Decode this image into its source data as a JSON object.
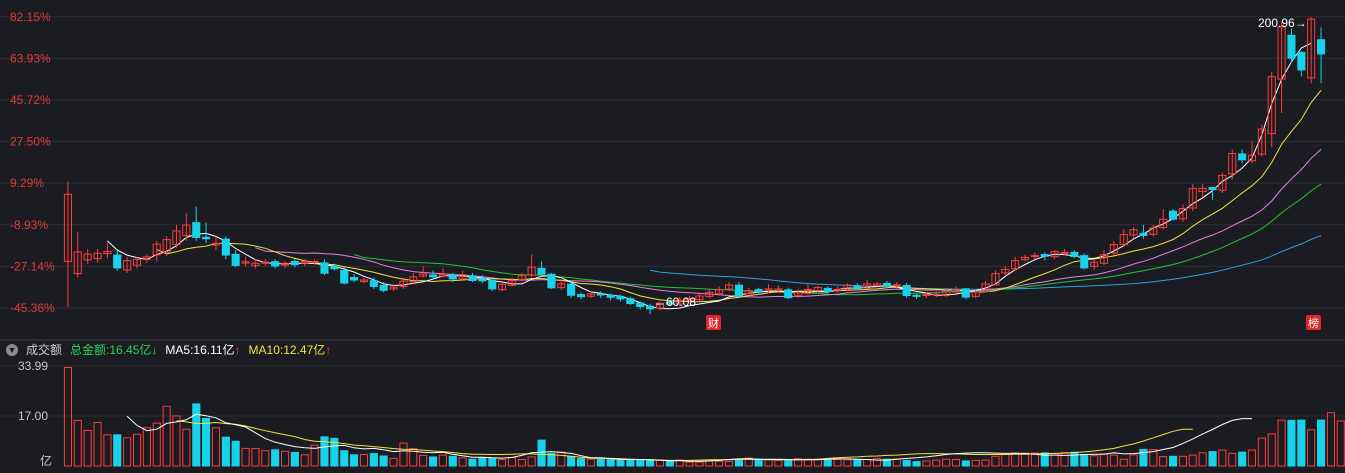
{
  "colors": {
    "up": "#ff3b3b",
    "down": "#19d2ea",
    "ma5": "#ffffff",
    "ma10": "#f2e33c",
    "ma20": "#e67ee6",
    "ma30": "#22c234",
    "ma60": "#2f9fe0",
    "grid": "#2c2e35"
  },
  "volume_header": {
    "collapse_icon": "triangle-down-icon",
    "name": "成交额",
    "total_label": "总金额:16.45亿",
    "total_arrow": "↓",
    "ma5_label": "MA5:16.11亿",
    "ma5_arrow": "↑",
    "ma10_label": "MA10:12.47亿",
    "ma10_arrow": "↑"
  },
  "annotations": {
    "high_label": "200.96→",
    "low_label": "←60.08",
    "badge_cai": "财",
    "badge_bang": "榜"
  },
  "chart_data": [
    {
      "type": "candlestick",
      "y_axis_format": "percent",
      "yticks": [
        "82.15%",
        "63.93%",
        "45.72%",
        "27.50%",
        "9.29%",
        "-8.93%",
        "-27.14%",
        "-45.36%"
      ],
      "ytick_values": [
        82.15,
        63.93,
        45.72,
        27.5,
        9.29,
        -8.93,
        -27.14,
        -45.36
      ],
      "ylim": [
        -55,
        86
      ],
      "candles": [
        [
          -25.0,
          4.4,
          10.0,
          -45.0
        ],
        [
          -30.3,
          -20.8,
          -12.0,
          -32.0
        ],
        [
          -24.3,
          -21.7,
          -19.5,
          -26.0
        ],
        [
          -23.7,
          -21.4,
          -19.5,
          -25.5
        ],
        [
          -21.5,
          -20.6,
          -17.0,
          -23.5
        ],
        [
          -22.2,
          -27.8,
          -20.0,
          -29.0
        ],
        [
          -28.7,
          -24.6,
          -23.0,
          -30.0
        ],
        [
          -26.7,
          -24.1,
          -23.0,
          -28.0
        ],
        [
          -24.2,
          -23.0,
          -22.0,
          -25.5
        ],
        [
          -22.1,
          -17.4,
          -16.0,
          -25.0
        ],
        [
          -21.0,
          -15.4,
          -14.0,
          -22.5
        ],
        [
          -17.5,
          -11.6,
          -9.0,
          -19.0
        ],
        [
          -13.6,
          -9.0,
          -4.0,
          -16.0
        ],
        [
          -8.0,
          -14.5,
          -1.0,
          -16.0
        ],
        [
          -14.4,
          -15.0,
          -8.0,
          -17.0
        ],
        [
          -17.8,
          -17.1,
          -14.0,
          -20.0
        ],
        [
          -15.2,
          -22.2,
          -14.0,
          -24.0
        ],
        [
          -21.9,
          -26.7,
          -20.0,
          -27.5
        ],
        [
          -25.7,
          -25.1,
          -23.0,
          -27.0
        ],
        [
          -26.8,
          -25.8,
          -24.0,
          -28.0
        ],
        [
          -25.8,
          -25.3,
          -24.0,
          -27.0
        ],
        [
          -25.1,
          -27.0,
          -24.0,
          -28.0
        ],
        [
          -26.6,
          -25.8,
          -25.0,
          -28.0
        ],
        [
          -25.0,
          -26.4,
          -24.0,
          -27.5
        ],
        [
          -25.7,
          -25.0,
          -24.0,
          -27.0
        ],
        [
          -25.4,
          -25.0,
          -24.0,
          -26.5
        ],
        [
          -25.6,
          -30.1,
          -24.0,
          -31.0
        ],
        [
          -27.3,
          -28.2,
          -26.0,
          -29.0
        ],
        [
          -28.9,
          -34.4,
          -27.0,
          -35.0
        ],
        [
          -32.0,
          -33.1,
          -30.5,
          -34.0
        ],
        [
          -33.8,
          -33.1,
          -32.0,
          -34.5
        ],
        [
          -33.4,
          -35.9,
          -32.0,
          -37.0
        ],
        [
          -35.5,
          -37.6,
          -34.0,
          -38.5
        ],
        [
          -37.0,
          -36.2,
          -35.0,
          -38.0
        ],
        [
          -36.0,
          -33.6,
          -32.0,
          -37.0
        ],
        [
          -33.8,
          -31.7,
          -30.0,
          -35.0
        ],
        [
          -31.4,
          -30.5,
          -27.0,
          -32.0
        ],
        [
          -30.9,
          -31.7,
          -29.0,
          -33.0
        ],
        [
          -31.4,
          -30.6,
          -28.0,
          -32.0
        ],
        [
          -30.9,
          -32.6,
          -30.0,
          -34.0
        ],
        [
          -32.6,
          -30.8,
          -29.0,
          -33.0
        ],
        [
          -31.3,
          -33.3,
          -30.0,
          -34.0
        ],
        [
          -32.6,
          -33.5,
          -31.0,
          -34.5
        ],
        [
          -33.3,
          -37.0,
          -32.5,
          -38.0
        ],
        [
          -37.3,
          -35.0,
          -34.0,
          -38.0
        ],
        [
          -35.4,
          -33.4,
          -32.0,
          -36.0
        ],
        [
          -33.0,
          -31.2,
          -30.0,
          -34.0
        ],
        [
          -31.0,
          -27.5,
          -22.0,
          -32.0
        ],
        [
          -28.0,
          -30.6,
          -25.0,
          -31.5
        ],
        [
          -30.6,
          -36.5,
          -30.0,
          -37.0
        ],
        [
          -36.4,
          -34.8,
          -33.0,
          -37.5
        ],
        [
          -34.9,
          -39.8,
          -34.0,
          -41.0
        ],
        [
          -39.5,
          -40.4,
          -38.5,
          -41.5
        ],
        [
          -40.2,
          -39.2,
          -38.0,
          -41.0
        ],
        [
          -39.2,
          -39.7,
          -38.0,
          -41.0
        ],
        [
          -39.7,
          -40.6,
          -39.0,
          -42.0
        ],
        [
          -40.3,
          -41.4,
          -39.5,
          -42.5
        ],
        [
          -41.3,
          -43.4,
          -40.5,
          -44.0
        ],
        [
          -43.2,
          -44.7,
          -42.5,
          -46.0
        ],
        [
          -44.6,
          -45.8,
          -43.5,
          -48.0
        ],
        [
          -45.4,
          -43.3,
          -42.5,
          -46.5
        ],
        [
          -43.0,
          -43.7,
          -42.0,
          -44.5
        ],
        [
          -43.6,
          -41.9,
          -40.5,
          -44.5
        ],
        [
          -42.2,
          -41.2,
          -40.0,
          -43.0
        ],
        [
          -41.7,
          -40.1,
          -39.0,
          -42.5
        ],
        [
          -40.3,
          -38.5,
          -37.0,
          -41.0
        ],
        [
          -39.1,
          -37.4,
          -36.0,
          -40.0
        ],
        [
          -37.1,
          -35.3,
          -34.0,
          -38.0
        ],
        [
          -35.4,
          -40.0,
          -34.0,
          -41.0
        ],
        [
          -39.0,
          -37.7,
          -36.5,
          -40.0
        ],
        [
          -37.3,
          -38.2,
          -36.5,
          -39.5
        ],
        [
          -37.6,
          -37.0,
          -35.0,
          -39.0
        ],
        [
          -37.6,
          -37.0,
          -35.5,
          -38.5
        ],
        [
          -37.4,
          -40.8,
          -36.5,
          -41.5
        ],
        [
          -40.0,
          -38.6,
          -37.0,
          -41.0
        ],
        [
          -38.9,
          -37.2,
          -35.0,
          -39.5
        ],
        [
          -37.7,
          -36.4,
          -35.5,
          -38.5
        ],
        [
          -36.8,
          -38.1,
          -36.0,
          -39.0
        ],
        [
          -37.8,
          -37.2,
          -36.0,
          -38.5
        ],
        [
          -37.2,
          -35.3,
          -34.5,
          -38.0
        ],
        [
          -35.7,
          -36.9,
          -34.5,
          -37.5
        ],
        [
          -36.6,
          -34.8,
          -33.0,
          -37.0
        ],
        [
          -35.5,
          -34.8,
          -34.0,
          -36.5
        ],
        [
          -34.6,
          -35.6,
          -33.5,
          -36.5
        ],
        [
          -35.2,
          -35.2,
          -34.0,
          -36.5
        ],
        [
          -35.5,
          -39.9,
          -34.5,
          -41.0
        ],
        [
          -39.8,
          -40.3,
          -39.0,
          -41.5
        ],
        [
          -39.9,
          -39.4,
          -38.5,
          -41.0
        ],
        [
          -39.7,
          -39.3,
          -38.0,
          -40.5
        ],
        [
          -39.9,
          -38.0,
          -37.0,
          -40.5
        ],
        [
          -38.3,
          -37.4,
          -36.0,
          -39.0
        ],
        [
          -37.0,
          -40.6,
          -36.5,
          -41.5
        ],
        [
          -40.3,
          -38.4,
          -37.5,
          -41.0
        ],
        [
          -38.1,
          -34.8,
          -33.5,
          -38.5
        ],
        [
          -35.2,
          -30.3,
          -29.0,
          -35.5
        ],
        [
          -30.0,
          -28.5,
          -27.0,
          -31.0
        ],
        [
          -28.1,
          -24.6,
          -23.0,
          -29.0
        ],
        [
          -24.2,
          -23.2,
          -22.0,
          -25.0
        ],
        [
          -22.8,
          -22.4,
          -21.0,
          -24.0
        ],
        [
          -22.0,
          -22.7,
          -21.0,
          -24.5
        ],
        [
          -22.9,
          -20.7,
          -20.0,
          -24.0
        ],
        [
          -21.0,
          -21.0,
          -19.5,
          -22.5
        ],
        [
          -21.0,
          -22.8,
          -20.0,
          -23.5
        ],
        [
          -22.4,
          -27.8,
          -21.5,
          -28.5
        ],
        [
          -27.1,
          -25.3,
          -24.0,
          -28.5
        ],
        [
          -25.8,
          -22.0,
          -20.0,
          -26.5
        ],
        [
          -21.3,
          -17.6,
          -16.0,
          -22.0
        ],
        [
          -17.6,
          -13.2,
          -11.0,
          -18.5
        ],
        [
          -13.4,
          -11.1,
          -10.0,
          -15.0
        ],
        [
          -12.7,
          -13.6,
          -9.0,
          -15.0
        ],
        [
          -13.1,
          -10.3,
          -9.0,
          -14.0
        ],
        [
          -10.2,
          -6.5,
          -2.0,
          -11.0
        ],
        [
          -3.0,
          -6.5,
          -2.0,
          -7.0
        ],
        [
          -6.3,
          -1.8,
          0.0,
          -7.5
        ],
        [
          -1.6,
          7.0,
          9.0,
          -3.0
        ],
        [
          5.6,
          7.0,
          9.0,
          3.0
        ],
        [
          7.4,
          6.5,
          7.5,
          2.0
        ],
        [
          6.2,
          12.7,
          14.0,
          5.0
        ],
        [
          13.4,
          22.3,
          24.0,
          11.0
        ],
        [
          22.1,
          19.5,
          24.0,
          18.0
        ],
        [
          19.1,
          21.5,
          28.0,
          18.0
        ],
        [
          22.0,
          33.0,
          35.0,
          21.0
        ],
        [
          31.0,
          55.9,
          58.0,
          25.0
        ],
        [
          54.9,
          77.7,
          80.0,
          40.0
        ],
        [
          74.0,
          64.0,
          77.0,
          62.0
        ],
        [
          66.6,
          58.9,
          67.0,
          56.0
        ],
        [
          55.4,
          81.1,
          82.0,
          53.0
        ],
        [
          72.1,
          65.9,
          77.5,
          53.0
        ]
      ],
      "ma5": [
        null,
        null,
        null,
        null,
        -16.0,
        -20.0,
        -22.2,
        -23.3,
        -24.1,
        -22.0,
        -20.6,
        -18.1,
        -14.5,
        -13.1,
        -12.7,
        -14.0,
        -16.2,
        -19.3,
        -21.8,
        -24.2,
        -25.5,
        -26.0,
        -26.0,
        -25.9,
        -25.8,
        -25.9,
        -26.4,
        -27.0,
        -28.3,
        -29.6,
        -31.5,
        -33.0,
        -34.8,
        -35.5,
        -35.3,
        -34.5,
        -33.9,
        -32.7,
        -31.3,
        -31.2,
        -31.3,
        -31.8,
        -32.2,
        -33.4,
        -34.0,
        -34.8,
        -34.8,
        -32.8,
        -31.5,
        -31.2,
        -32.1,
        -34.1,
        -36.4,
        -38.3,
        -38.9,
        -39.7,
        -40.2,
        -41.5,
        -43.0,
        -44.8,
        -45.6,
        -45.7,
        -45.4,
        -44.3,
        -43.6,
        -42.9,
        -42.3,
        -40.5,
        -39.8,
        -38.9,
        -38.4,
        -38.0,
        -37.8,
        -38.3,
        -38.3,
        -38.5,
        -38.2,
        -38.4,
        -37.3,
        -36.6,
        -36.8,
        -36.2,
        -36.0,
        -35.4,
        -36.3,
        -37.2,
        -38.1,
        -38.8,
        -40.0,
        -39.6,
        -39.3,
        -38.5,
        -37.7,
        -36.6,
        -34.9,
        -31.5,
        -28.6,
        -26.3,
        -24.2,
        -22.7,
        -21.8,
        -22.0,
        -22.6,
        -23.5,
        -23.7,
        -22.5,
        -20.4,
        -18.1,
        -15.1,
        -12.9,
        -10.3,
        -8.6,
        -6.2,
        -3.0,
        0.3,
        2.9,
        6.0,
        10.1,
        12.6,
        15.9,
        20.3,
        30.5,
        44.1,
        54.8,
        62.5,
        68.5,
        70.6
      ]
    },
    {
      "type": "bar",
      "name": "成交额",
      "unit": "亿",
      "yticks": [
        "33.99",
        "17.00"
      ],
      "ytick_values": [
        33.99,
        17.0
      ],
      "ylim": [
        0,
        34
      ],
      "volumes": [
        33.5,
        15.5,
        12.1,
        14.8,
        10.6,
        10.6,
        9.6,
        10.8,
        13.0,
        14.6,
        20.3,
        17.0,
        12.5,
        21.1,
        16.2,
        13.0,
        9.8,
        8.4,
        6.0,
        5.9,
        5.2,
        5.5,
        5.0,
        4.6,
        3.8,
        7.1,
        9.9,
        9.4,
        5.2,
        3.8,
        3.9,
        4.2,
        3.4,
        2.6,
        7.8,
        5.9,
        3.6,
        3.1,
        3.7,
        3.3,
        2.8,
        2.3,
        2.9,
        2.5,
        2.2,
        2.9,
        2.2,
        3.1,
        8.8,
        4.3,
        4.8,
        3.1,
        2.5,
        2.3,
        2.2,
        2.2,
        1.9,
        2.3,
        2.1,
        1.9,
        1.9,
        1.6,
        2.0,
        1.3,
        1.3,
        1.9,
        1.6,
        1.5,
        2.3,
        2.7,
        2.4,
        2.2,
        1.9,
        2.2,
        2.5,
        2.3,
        2.3,
        2.0,
        2.2,
        2.1,
        2.1,
        2.2,
        2.6,
        2.3,
        2.4,
        1.9,
        1.5,
        1.7,
        2.0,
        2.3,
        2.2,
        1.7,
        1.9,
        2.0,
        3.3,
        3.9,
        4.1,
        4.4,
        4.4,
        4.5,
        4.2,
        4.6,
        4.7,
        3.9,
        3.5,
        4.1,
        3.7,
        2.3,
        3.8,
        5.6,
        5.6,
        3.2,
        3.3,
        3.3,
        3.7,
        4.5,
        4.9,
        5.4,
        4.3,
        4.7,
        5.4,
        9.5,
        10.9,
        15.6,
        15.5,
        15.6,
        12.3,
        15.6,
        18.1,
        15.3,
        15.8
      ],
      "ma5": [
        null,
        null,
        null,
        null,
        null,
        null,
        16.9,
        13.8,
        12.0,
        12.5,
        14.5,
        15.0,
        15.7,
        17.6,
        17.1,
        16.4,
        14.7,
        14.0,
        13.3,
        11.3,
        9.3,
        8.1,
        7.3,
        6.6,
        6.2,
        6.0,
        6.5,
        6.9,
        7.0,
        6.2,
        5.8,
        6.0,
        5.5,
        4.9,
        5.2,
        5.0,
        4.7,
        4.5,
        4.7,
        4.0,
        3.5,
        3.0,
        3.0,
        2.8,
        2.7,
        2.9,
        3.6,
        4.5,
        4.7,
        4.9,
        4.6,
        4.3,
        3.5,
        2.8,
        2.8,
        2.5,
        2.2,
        2.2,
        2.2,
        2.1,
        2.0,
        1.8,
        1.8,
        1.6,
        1.6,
        1.7,
        1.9,
        2.2,
        2.4,
        2.5,
        2.2,
        2.3,
        2.3,
        2.2,
        2.1,
        2.1,
        2.1,
        2.3,
        2.4,
        2.4,
        2.3,
        2.2,
        2.0,
        2.0,
        2.3,
        2.6,
        2.8,
        3.1,
        3.5,
        3.9,
        4.2,
        4.4,
        4.5,
        4.5,
        4.4,
        4.3,
        4.4,
        4.2,
        4.0,
        3.7,
        3.7,
        3.6,
        3.7,
        3.9,
        4.0,
        4.0,
        4.5,
        4.1,
        4.2,
        4.6,
        4.9,
        5.6,
        6.3,
        7.7,
        9.2,
        10.9,
        12.4,
        14.1,
        15.5,
        16.1,
        16.1
      ],
      "ma10": [
        null,
        null,
        null,
        null,
        null,
        null,
        null,
        null,
        null,
        null,
        null,
        15.4,
        15.0,
        14.5,
        14.5,
        14.8,
        14.4,
        14.2,
        13.6,
        12.8,
        12.0,
        11.3,
        10.6,
        10.0,
        9.0,
        8.4,
        8.3,
        8.0,
        7.6,
        7.1,
        6.9,
        6.6,
        6.3,
        5.9,
        5.7,
        5.6,
        5.4,
        5.1,
        4.9,
        4.6,
        4.2,
        4.0,
        4.0,
        3.9,
        3.9,
        4.0,
        4.1,
        4.1,
        3.9,
        3.8,
        3.6,
        3.3,
        3.0,
        2.7,
        2.6,
        2.6,
        2.5,
        2.3,
        2.2,
        2.1,
        2.0,
        1.9,
        1.9,
        1.9,
        2.0,
        2.1,
        2.1,
        2.1,
        2.2,
        2.3,
        2.2,
        2.1,
        2.1,
        2.1,
        2.1,
        2.2,
        2.3,
        2.6,
        2.8,
        3.0,
        3.1,
        3.3,
        3.4,
        3.6,
        3.7,
        3.9,
        4.1,
        4.2,
        4.2,
        4.1,
        4.1,
        4.0,
        3.9,
        3.9,
        3.9,
        3.9,
        4.0,
        4.0,
        4.1,
        4.2,
        4.3,
        4.4,
        4.6,
        4.8,
        5.1,
        5.5,
        6.0,
        6.8,
        7.5,
        8.5,
        9.6,
        10.7,
        11.8,
        12.5,
        12.5
      ]
    }
  ]
}
